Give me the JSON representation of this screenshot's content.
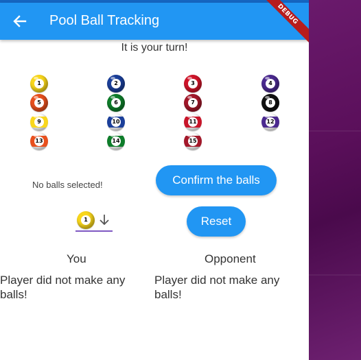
{
  "appbar": {
    "title": "Pool Ball Tracking",
    "debug_label": "DEBUG"
  },
  "turn_text": "It is your turn!",
  "balls": [
    {
      "num": "1",
      "color": "#f9d71c",
      "stripe": false
    },
    {
      "num": "2",
      "color": "#1b3f9a",
      "stripe": false
    },
    {
      "num": "3",
      "color": "#d0152a",
      "stripe": false
    },
    {
      "num": "4",
      "color": "#4b2a8f",
      "stripe": false
    },
    {
      "num": "5",
      "color": "#e8501e",
      "stripe": false
    },
    {
      "num": "6",
      "color": "#0e7d2a",
      "stripe": false
    },
    {
      "num": "7",
      "color": "#a3182a",
      "stripe": false
    },
    {
      "num": "8",
      "color": "#111111",
      "stripe": false
    },
    {
      "num": "9",
      "color": "#f9d71c",
      "stripe": true
    },
    {
      "num": "10",
      "color": "#1b3f9a",
      "stripe": true
    },
    {
      "num": "11",
      "color": "#c8162a",
      "stripe": true
    },
    {
      "num": "12",
      "color": "#4b2a8f",
      "stripe": true
    },
    {
      "num": "13",
      "color": "#e8501e",
      "stripe": true
    },
    {
      "num": "14",
      "color": "#0e7d2a",
      "stripe": true
    },
    {
      "num": "15",
      "color": "#a3182a",
      "stripe": true
    }
  ],
  "selection_status": "No balls selected!",
  "buttons": {
    "confirm": "Confirm the balls",
    "reset": "Reset"
  },
  "dropdown": {
    "selected_ball": "1",
    "selected_color": "#f9d71c"
  },
  "players": {
    "you": {
      "label": "You",
      "result": "Player did not make any balls!"
    },
    "opponent": {
      "label": "Opponent",
      "result": "Player did not make any balls!"
    }
  },
  "colors": {
    "primary": "#2196f3",
    "accent": "#7e57c2",
    "debug": "#b71c1c"
  }
}
